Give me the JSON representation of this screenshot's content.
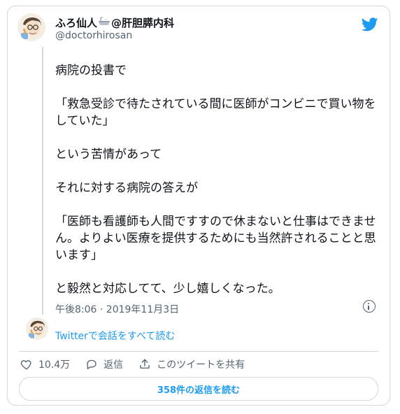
{
  "author": {
    "display_name": "ふろ仙人",
    "name_emoji": "bathtub-icon",
    "name_suffix": "@肝胆膵内科",
    "handle": "@doctorhirosan"
  },
  "tweet": {
    "paragraphs": [
      "病院の投書で",
      "「救急受診で待たされている間に医師がコンビニで買い物をしていた」",
      "という苦情があって",
      "それに対する病院の答えが",
      "「医師も看護師も人間ですすので休まないと仕事はできません。よりよい医療を提供するためにも当然許されることと思います」",
      "と毅然と対応してて、少し嬉しくなった。"
    ],
    "timestamp": "午後8:06 · 2019年11月3日"
  },
  "thread": {
    "link_text": "Twitterで会話をすべて読む"
  },
  "actions": {
    "like_count": "10.4万",
    "reply_label": "返信",
    "share_label": "このツイートを共有"
  },
  "replies_button": "358件の返信を読む",
  "colors": {
    "accent": "#1d9bf0",
    "muted": "#536471",
    "border": "#cfd9de"
  }
}
